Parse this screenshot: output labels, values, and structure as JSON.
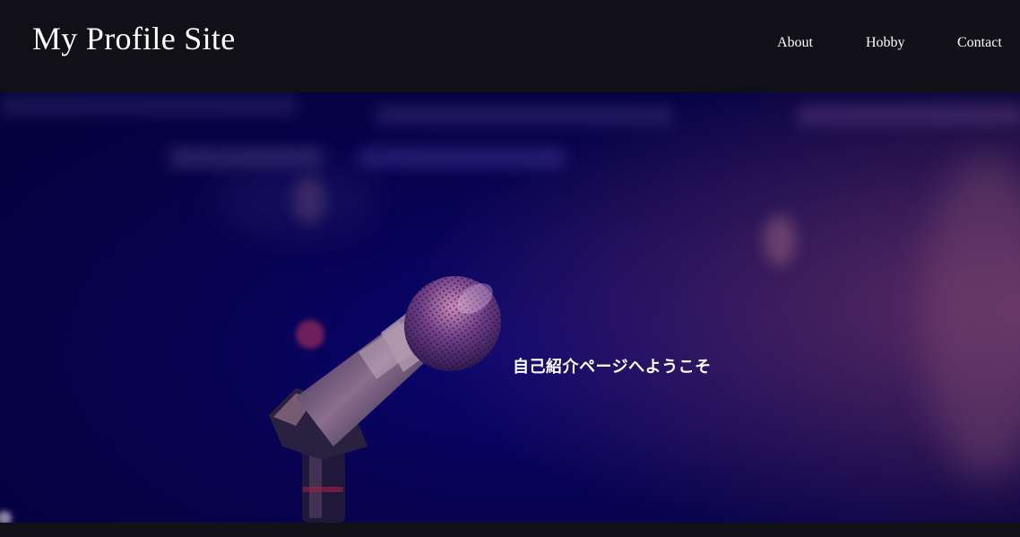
{
  "header": {
    "site_title": "My Profile Site",
    "nav": [
      {
        "label": "About"
      },
      {
        "label": "Hobby"
      },
      {
        "label": "Contact"
      }
    ]
  },
  "hero": {
    "welcome_text": "自己紹介ページへようこそ",
    "image_subject": "microphone-on-stand"
  },
  "colors": {
    "header_bg": "#121017",
    "hero_bg": "#07034f",
    "text": "#ffffff"
  }
}
